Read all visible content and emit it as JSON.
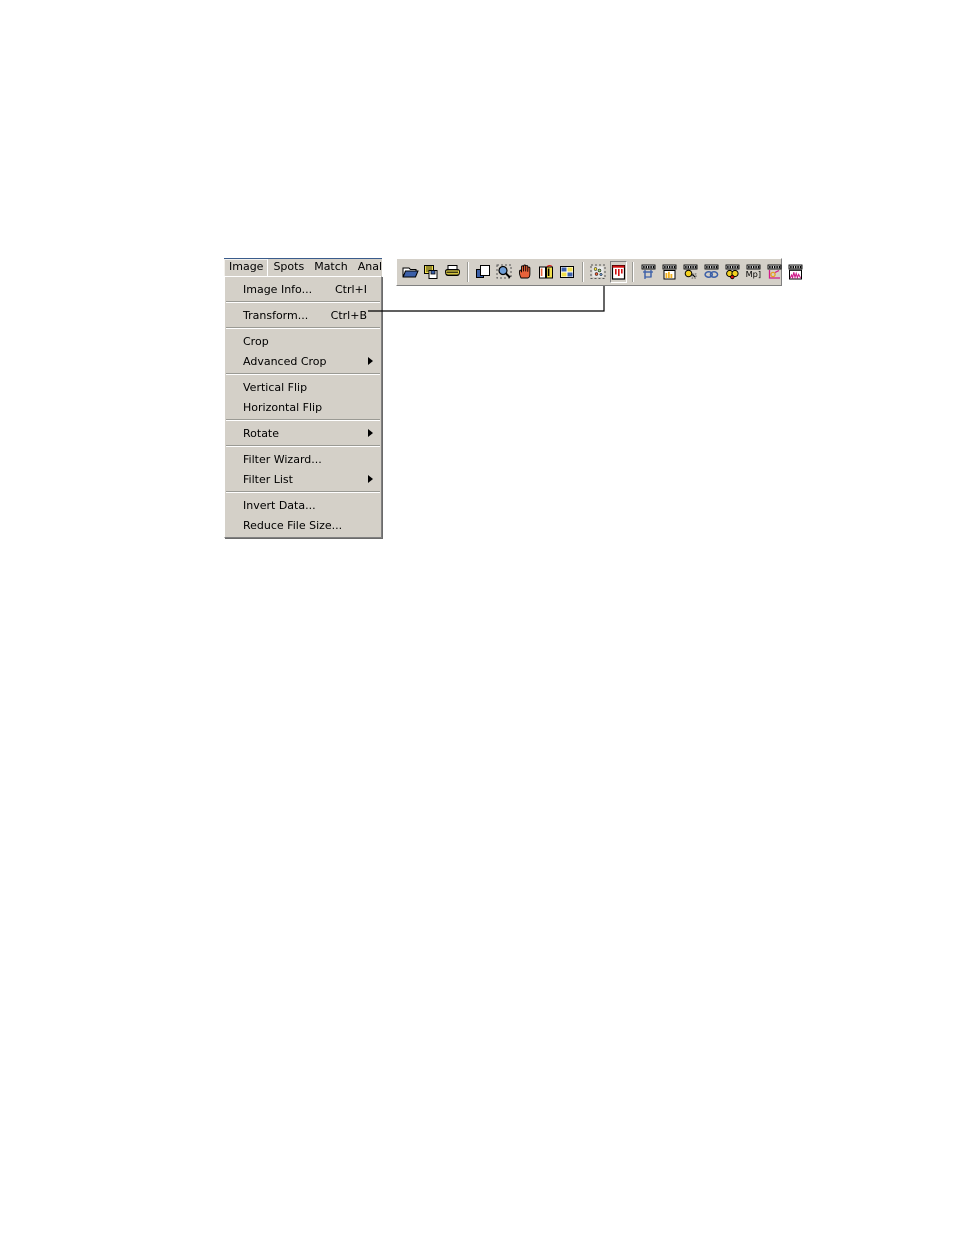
{
  "menubar": {
    "items": [
      {
        "label": "Image",
        "open": true
      },
      {
        "label": "Spots",
        "open": false
      },
      {
        "label": "Match",
        "open": false
      },
      {
        "label": "Analysis",
        "open": false
      }
    ]
  },
  "dropdown": {
    "title": "Image",
    "groups": [
      {
        "items": [
          {
            "label": "Image Info...",
            "accel": "Ctrl+I",
            "submenu": false
          }
        ]
      },
      {
        "items": [
          {
            "label": "Transform...",
            "accel": "Ctrl+B",
            "submenu": false
          }
        ]
      },
      {
        "items": [
          {
            "label": "Crop",
            "accel": "",
            "submenu": false
          },
          {
            "label": "Advanced Crop",
            "accel": "",
            "submenu": true
          }
        ]
      },
      {
        "items": [
          {
            "label": "Vertical Flip",
            "accel": "",
            "submenu": false
          },
          {
            "label": "Horizontal Flip",
            "accel": "",
            "submenu": false
          }
        ]
      },
      {
        "items": [
          {
            "label": "Rotate",
            "accel": "",
            "submenu": true
          }
        ]
      },
      {
        "items": [
          {
            "label": "Filter Wizard...",
            "accel": "",
            "submenu": false
          },
          {
            "label": "Filter List",
            "accel": "",
            "submenu": true
          }
        ]
      },
      {
        "items": [
          {
            "label": "Invert Data...",
            "accel": "",
            "submenu": false
          },
          {
            "label": "Reduce File Size...",
            "accel": "",
            "submenu": false
          }
        ]
      }
    ]
  },
  "toolbar": {
    "groups": [
      {
        "buttons": [
          {
            "icon": "open-folder-icon",
            "name": "open-image-button",
            "pressed": false
          },
          {
            "icon": "save-image-icon",
            "name": "save-image-button",
            "pressed": false
          },
          {
            "icon": "print-icon",
            "name": "print-button",
            "pressed": false
          }
        ]
      },
      {
        "buttons": [
          {
            "icon": "new-window-icon",
            "name": "new-window-button",
            "pressed": false
          },
          {
            "icon": "zoom-select-icon",
            "name": "zoom-select-button",
            "pressed": false
          },
          {
            "icon": "hand-pan-icon",
            "name": "pan-button",
            "pressed": false
          },
          {
            "icon": "compare-images-icon",
            "name": "compare-images-button",
            "pressed": false
          },
          {
            "icon": "tile-windows-icon",
            "name": "tile-windows-button",
            "pressed": false
          }
        ]
      },
      {
        "buttons": [
          {
            "icon": "spot-detection-icon",
            "name": "spot-detection-button",
            "pressed": false
          },
          {
            "icon": "transform-icon",
            "name": "transform-button",
            "pressed": true
          }
        ]
      },
      {
        "buttons": [
          {
            "icon": "gel-crop-icon",
            "name": "gel-crop-button",
            "pressed": false
          },
          {
            "icon": "gel-bands-icon",
            "name": "gel-bands-button",
            "pressed": false
          },
          {
            "icon": "gel-spot-pick-icon",
            "name": "gel-spot-pick-button",
            "pressed": false
          },
          {
            "icon": "gel-link-icon",
            "name": "gel-link-button",
            "pressed": false
          },
          {
            "icon": "gel-match-icon",
            "name": "gel-match-button",
            "pressed": false
          },
          {
            "icon": "gel-mw-icon",
            "name": "gel-molecular-weight-button",
            "pressed": false
          },
          {
            "icon": "gel-axes-icon",
            "name": "gel-calibration-button",
            "pressed": false
          },
          {
            "icon": "gel-profile-icon",
            "name": "gel-profile-button",
            "pressed": false
          }
        ]
      }
    ],
    "mw_label": "Mp]"
  },
  "callout": {
    "from": "Transform... Ctrl+B",
    "to": "transform-button",
    "color": "#000000"
  }
}
